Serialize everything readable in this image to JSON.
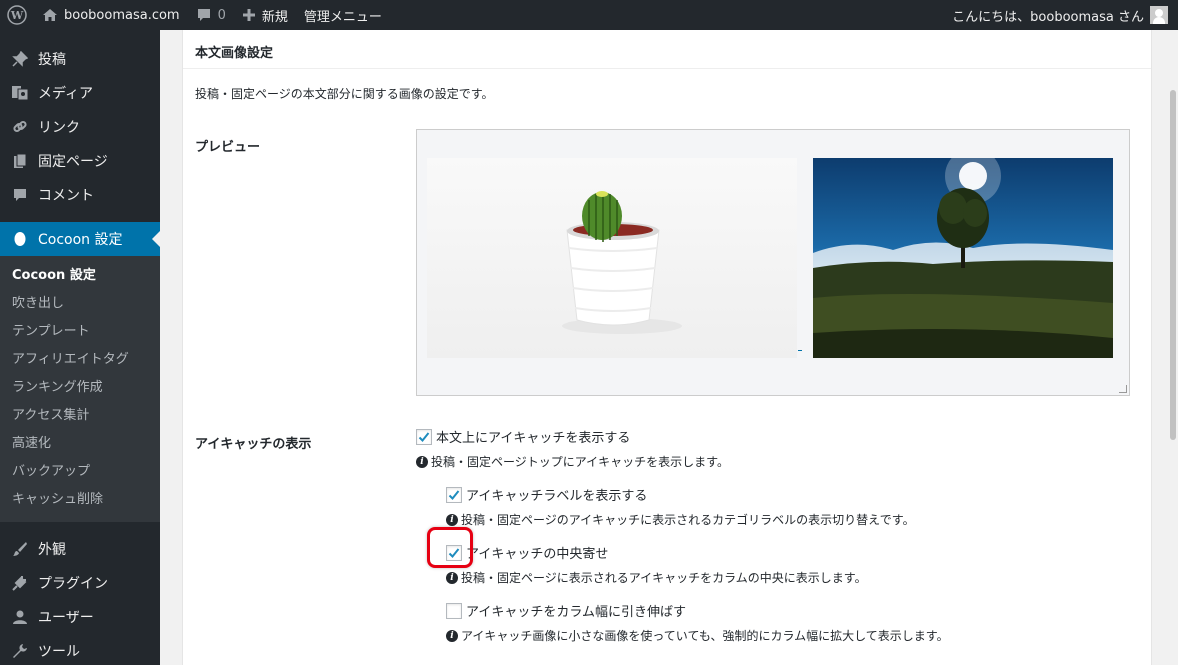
{
  "admin_bar": {
    "site_name": "booboomasa.com",
    "comments_count": "0",
    "new_label": "新規",
    "admin_menu_label": "管理メニュー",
    "greeting": "こんにちは、booboomasa さん"
  },
  "sidebar": {
    "items_top": [
      {
        "label": "投稿",
        "icon": "pin-icon"
      },
      {
        "label": "メディア",
        "icon": "media-icon"
      },
      {
        "label": "リンク",
        "icon": "link-icon"
      },
      {
        "label": "固定ページ",
        "icon": "page-icon"
      },
      {
        "label": "コメント",
        "icon": "comment-icon"
      }
    ],
    "active": {
      "label": "Cocoon 設定",
      "icon": "cocoon-icon"
    },
    "submenu": [
      {
        "label": "Cocoon 設定",
        "current": true
      },
      {
        "label": "吹き出し"
      },
      {
        "label": "テンプレート"
      },
      {
        "label": "アフィリエイトタグ"
      },
      {
        "label": "ランキング作成"
      },
      {
        "label": "アクセス集計"
      },
      {
        "label": "高速化"
      },
      {
        "label": "バックアップ"
      },
      {
        "label": "キャッシュ削除"
      }
    ],
    "items_bottom": [
      {
        "label": "外観",
        "icon": "brush-icon"
      },
      {
        "label": "プラグイン",
        "icon": "plugin-icon"
      },
      {
        "label": "ユーザー",
        "icon": "user-icon"
      },
      {
        "label": "ツール",
        "icon": "wrench-icon"
      }
    ]
  },
  "panel": {
    "title": "本文画像設定",
    "description": "投稿・固定ページの本文部分に関する画像の設定です。",
    "preview_label": "プレビュー",
    "eyecatch_label": "アイキャッチの表示",
    "options": [
      {
        "label": "本文上にアイキャッチを表示する",
        "checked": true,
        "hint": "投稿・固定ページトップにアイキャッチを表示します。"
      },
      {
        "label": "アイキャッチラベルを表示する",
        "checked": true,
        "hint": "投稿・固定ページのアイキャッチに表示されるカテゴリラベルの表示切り替えです。"
      },
      {
        "label": "アイキャッチの中央寄せ",
        "checked": true,
        "hint": "投稿・固定ページに表示されるアイキャッチをカラムの中央に表示します。"
      },
      {
        "label": "アイキャッチをカラム幅に引き伸ばす",
        "checked": false,
        "hint": "アイキャッチ画像に小さな画像を使っていても、強制的にカラム幅に拡大して表示します。"
      }
    ]
  },
  "colors": {
    "adminbar_bg": "#23282d",
    "active_menu": "#0073aa",
    "highlight": "#e60012"
  }
}
